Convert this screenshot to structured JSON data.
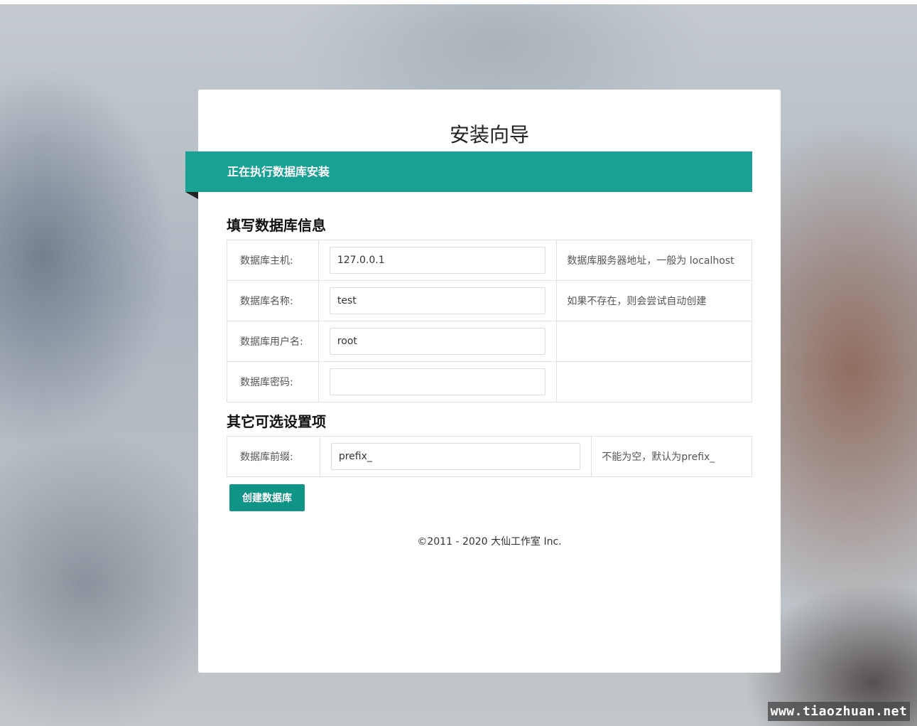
{
  "page": {
    "title": "安装向导",
    "ribbon": "正在执行数据库安装",
    "footer": "©2011 - 2020 大仙工作室 Inc."
  },
  "db_section": {
    "title": "填写数据库信息",
    "rows": [
      {
        "label": "数据库主机:",
        "value": "127.0.0.1",
        "hint": "数据库服务器地址，一般为 localhost"
      },
      {
        "label": "数据库名称:",
        "value": "test",
        "hint": "如果不存在，则会尝试自动创建"
      },
      {
        "label": "数据库用户名:",
        "value": "root",
        "hint": ""
      },
      {
        "label": "数据库密码:",
        "value": "",
        "hint": ""
      }
    ]
  },
  "other_section": {
    "title": "其它可选设置项",
    "rows": [
      {
        "label": "数据库前缀:",
        "value": "prefix_",
        "hint": "不能为空，默认为prefix_"
      }
    ]
  },
  "actions": {
    "create_label": "创建数据库"
  },
  "watermark": "www.tiaozhuan.net",
  "colors": {
    "accent": "#19a193",
    "button": "#109486"
  }
}
